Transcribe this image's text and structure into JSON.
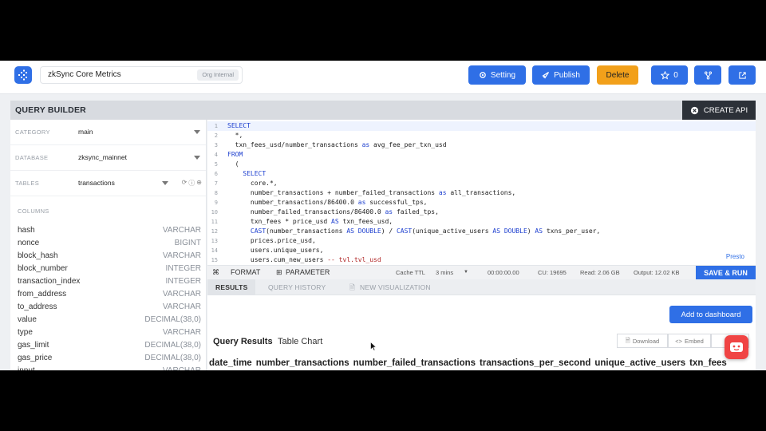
{
  "header": {
    "project_title": "zkSync Core Metrics",
    "org_badge": "Org Internal",
    "setting_label": "Setting",
    "publish_label": "Publish",
    "delete_label": "Delete",
    "star_count": "0"
  },
  "query_builder": {
    "title": "QUERY BUILDER",
    "create_api_label": "CREATE API",
    "category": {
      "label": "CATEGORY",
      "value": "main"
    },
    "database": {
      "label": "DATABASE",
      "value": "zksync_mainnet"
    },
    "tables": {
      "label": "TABLES",
      "value": "transactions"
    },
    "columns_label": "COLUMNS",
    "columns": [
      {
        "name": "hash",
        "type": "VARCHAR"
      },
      {
        "name": "nonce",
        "type": "BIGINT"
      },
      {
        "name": "block_hash",
        "type": "VARCHAR"
      },
      {
        "name": "block_number",
        "type": "INTEGER"
      },
      {
        "name": "transaction_index",
        "type": "INTEGER"
      },
      {
        "name": "from_address",
        "type": "VARCHAR"
      },
      {
        "name": "to_address",
        "type": "VARCHAR"
      },
      {
        "name": "value",
        "type": "DECIMAL(38,0)"
      },
      {
        "name": "type",
        "type": "VARCHAR"
      },
      {
        "name": "gas_limit",
        "type": "DECIMAL(38,0)"
      },
      {
        "name": "gas_price",
        "type": "DECIMAL(38,0)"
      },
      {
        "name": "input",
        "type": "VARCHAR"
      }
    ]
  },
  "editor": {
    "lines": [
      {
        "n": "1",
        "t": "SELECT"
      },
      {
        "n": "2",
        "t": "  *,"
      },
      {
        "n": "3",
        "t": "  txn_fees_usd/number_transactions as avg_fee_per_txn_usd"
      },
      {
        "n": "4",
        "t": "FROM"
      },
      {
        "n": "5",
        "t": "  ("
      },
      {
        "n": "6",
        "t": "    SELECT"
      },
      {
        "n": "7",
        "t": "      core.*,"
      },
      {
        "n": "8",
        "t": "      number_transactions + number_failed_transactions as all_transactions,"
      },
      {
        "n": "9",
        "t": "      number_transactions/86400.0 as successful_tps,"
      },
      {
        "n": "10",
        "t": "      number_failed_transactions/86400.0 as failed_tps,"
      },
      {
        "n": "11",
        "t": "      txn_fees * price_usd AS txn_fees_usd,"
      },
      {
        "n": "12",
        "t": "      CAST(number_transactions AS DOUBLE) / CAST(unique_active_users AS DOUBLE) AS txns_per_user,"
      },
      {
        "n": "13",
        "t": "      prices.price_usd,"
      },
      {
        "n": "14",
        "t": "      users.unique_users,"
      },
      {
        "n": "15",
        "t": "      users.cum_new_users -- tvl.tvl_usd"
      }
    ],
    "engine_label": "Presto"
  },
  "toolbar": {
    "format_label": "FORMAT",
    "parameter_label": "PARAMETER",
    "cache_ttl_label": "Cache TTL",
    "cache_ttl_value": "3 mins",
    "elapsed": "00:00:00.00",
    "cu": "CU: 19695",
    "read": "Read: 2.06 GB",
    "output": "Output: 12.02 KB",
    "save_run_label": "SAVE & RUN"
  },
  "result_tabs": {
    "results": "RESULTS",
    "history": "QUERY HISTORY",
    "new_viz": "NEW VISUALIZATION"
  },
  "results": {
    "add_dashboard_label": "Add to dashboard",
    "title": "Query Results",
    "table_chart_tab": "Table Chart",
    "download_label": "Download",
    "embed_label": "Embed",
    "columns": [
      "date_time",
      "number_transactions",
      "number_failed_transactions",
      "transactions_per_second",
      "unique_active_users",
      "txn_fees"
    ]
  },
  "colors": {
    "primary": "#2f6fe6",
    "delete": "#f2a01a",
    "dark": "#2c3138",
    "chat": "#f04444"
  }
}
